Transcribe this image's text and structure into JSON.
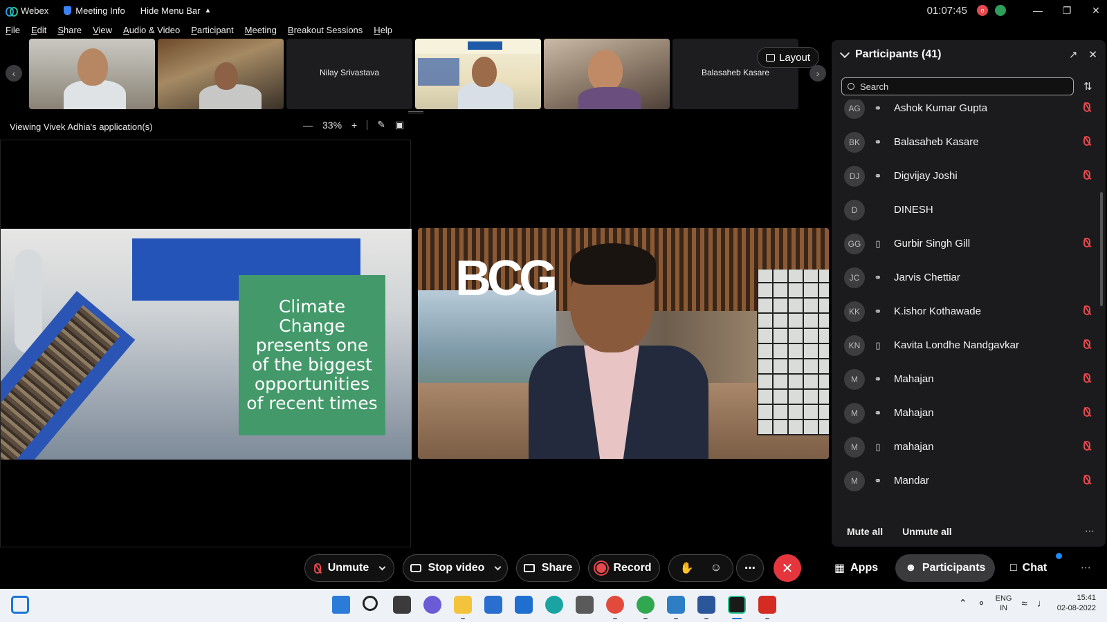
{
  "titlebar": {
    "app_name": "Webex",
    "meeting_info": "Meeting Info",
    "hide_menu": "Hide Menu Bar",
    "clock": "01:07:45",
    "rec_label": "o"
  },
  "menu": {
    "items": [
      "File",
      "Edit",
      "Share",
      "View",
      "Audio & Video",
      "Participant",
      "Meeting",
      "Breakout Sessions",
      "Help"
    ]
  },
  "strip": {
    "thumbs": [
      {
        "name": ""
      },
      {
        "name": ""
      },
      {
        "name": "Nilay Srivastava"
      },
      {
        "name": ""
      },
      {
        "name": ""
      },
      {
        "name": "Balasaheb Kasare"
      }
    ],
    "layout_label": "Layout"
  },
  "viewing": {
    "label": "Viewing Vivek Adhia's application(s)",
    "zoom": "33%"
  },
  "share": {
    "slide_text": "Climate Change presents one of the biggest opportunities of recent times"
  },
  "participants": {
    "title": "Participants (41)",
    "search_placeholder": "Search",
    "list": [
      {
        "initials": "AG",
        "name": "Ashok Kumar Gupta",
        "device": "audio",
        "muted": true
      },
      {
        "initials": "BK",
        "name": "Balasaheb Kasare",
        "device": "audio",
        "muted": true
      },
      {
        "initials": "DJ",
        "name": "Digvijay Joshi",
        "device": "audio",
        "muted": true
      },
      {
        "initials": "D",
        "name": "DINESH",
        "device": "none",
        "muted": false
      },
      {
        "initials": "GG",
        "name": "Gurbir Singh Gill",
        "device": "mobile",
        "muted": true
      },
      {
        "initials": "JC",
        "name": "Jarvis Chettiar",
        "device": "audio",
        "muted": false
      },
      {
        "initials": "KK",
        "name": "K.ishor Kothawade",
        "device": "audio",
        "muted": true
      },
      {
        "initials": "KN",
        "name": "Kavita Londhe Nandgavkar",
        "device": "mobile",
        "muted": true
      },
      {
        "initials": "M",
        "name": "Mahajan",
        "device": "audio",
        "muted": true
      },
      {
        "initials": "M",
        "name": "Mahajan",
        "device": "audio",
        "muted": true
      },
      {
        "initials": "M",
        "name": "mahajan",
        "device": "mobile",
        "muted": true
      },
      {
        "initials": "M",
        "name": "Mandar",
        "device": "audio",
        "muted": true
      }
    ],
    "mute_all": "Mute all",
    "unmute_all": "Unmute all"
  },
  "controls": {
    "unmute": "Unmute",
    "stop_video": "Stop video",
    "share": "Share",
    "record": "Record",
    "apps": "Apps",
    "participants": "Participants",
    "chat": "Chat"
  },
  "taskbar": {
    "lang_top": "ENG",
    "lang_bottom": "IN",
    "time": "15:41",
    "date": "02-08-2022"
  },
  "colors": {
    "mute_red": "#e5484d",
    "end_red": "#e5363d",
    "panel_bg": "#1b1b1d",
    "slide_green": "#44996b"
  }
}
